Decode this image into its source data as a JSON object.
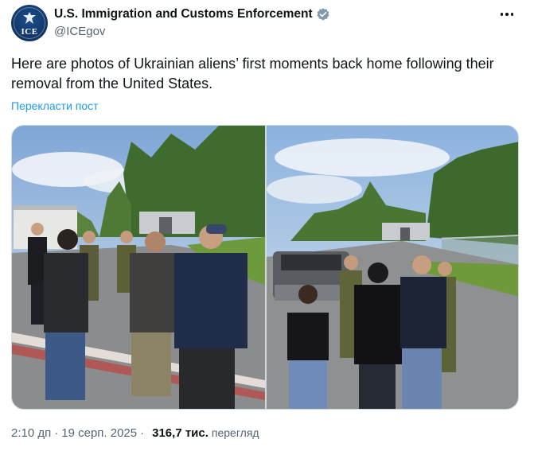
{
  "account": {
    "display_name": "U.S. Immigration and Customs Enforcement",
    "handle": "@ICEgov",
    "avatar_text": "ICE",
    "verified_color": "#829aab"
  },
  "tweet": {
    "text": "Here are photos of Ukrainian aliens’ first moments back home following their removal from the United States.",
    "translate_label": "Перекласти пост",
    "media_count": 2
  },
  "meta": {
    "time": "2:10 дп",
    "separator": "·",
    "date": "19 серп. 2025",
    "views_count": "316,7 тис.",
    "views_label": "перегляд"
  },
  "icons": {
    "more": "more-dots-icon",
    "verified": "verified-badge-icon",
    "avatar": "ice-seal-avatar"
  },
  "colors": {
    "link": "#1d9bf0",
    "secondary_text": "#536471",
    "primary_text": "#0f1419"
  }
}
